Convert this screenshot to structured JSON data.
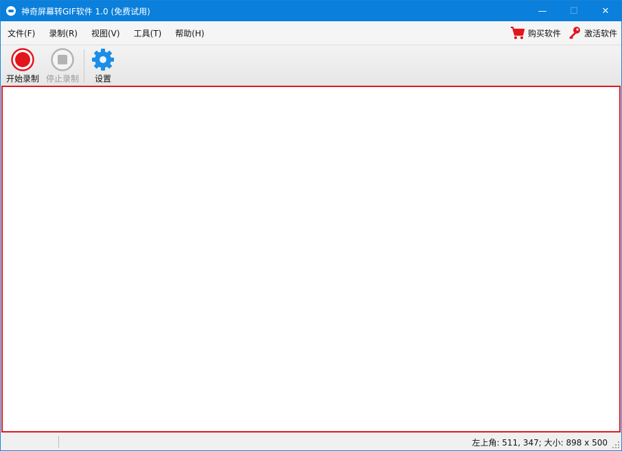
{
  "window": {
    "title": "神奇屏幕转GIF软件 1.0 (免费试用)",
    "controls": {
      "minimize": "—",
      "maximize": "☐",
      "close": "✕"
    }
  },
  "menubar": {
    "items": [
      {
        "label": "文件(F)"
      },
      {
        "label": "录制(R)"
      },
      {
        "label": "视图(V)"
      },
      {
        "label": "工具(T)"
      },
      {
        "label": "帮助(H)"
      }
    ],
    "buy": {
      "label": "购买软件",
      "icon": "cart-icon"
    },
    "activate": {
      "label": "激活软件",
      "icon": "key-icon"
    }
  },
  "toolbar": {
    "start": {
      "label": "开始录制",
      "icon": "record-icon"
    },
    "stop": {
      "label": "停止录制",
      "icon": "stop-icon"
    },
    "settings": {
      "label": "设置",
      "icon": "gear-icon"
    }
  },
  "statusbar": {
    "info": "左上角: 511, 347; 大小: 898 x 500"
  },
  "colors": {
    "titlebar": "#0a7fdb",
    "record_red": "#e3141c",
    "gear_blue": "#1a8ee8",
    "canvas_border": "#e3141c"
  }
}
